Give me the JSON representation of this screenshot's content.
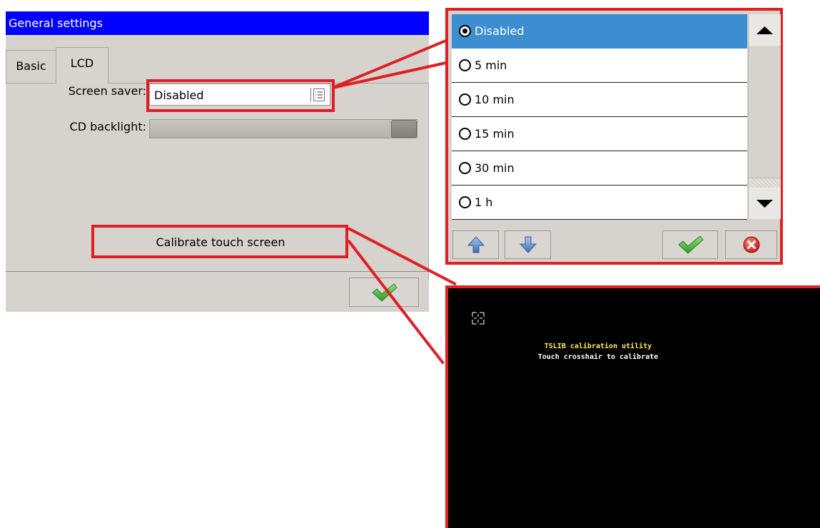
{
  "window": {
    "title": "General settings",
    "tabs": [
      "Basic",
      "LCD"
    ],
    "active_tab": "LCD",
    "screen_saver_label": "Screen saver:",
    "screen_saver_value": "Disabled",
    "backlight_label": "CD backlight:",
    "backlight_level": 1.0,
    "calibrate_label": "Calibrate touch screen"
  },
  "dropdown": {
    "items": [
      {
        "label": "Disabled",
        "selected": true
      },
      {
        "label": "5 min",
        "selected": false
      },
      {
        "label": "10 min",
        "selected": false
      },
      {
        "label": "15 min",
        "selected": false
      },
      {
        "label": "30 min",
        "selected": false
      },
      {
        "label": "1 h",
        "selected": false
      }
    ],
    "selected_color": "#3c8ed0"
  },
  "calibration": {
    "title": "TSLIB calibration utility",
    "subtitle": "Touch crosshair to calibrate",
    "title_color": "#ffea55"
  },
  "highlight_color": "#e01f24",
  "icons": [
    "list-icon",
    "checkmark-icon",
    "arrow-up-icon",
    "arrow-down-icon",
    "cancel-icon",
    "crosshair-icon",
    "triangle-up-icon",
    "triangle-down-icon"
  ]
}
